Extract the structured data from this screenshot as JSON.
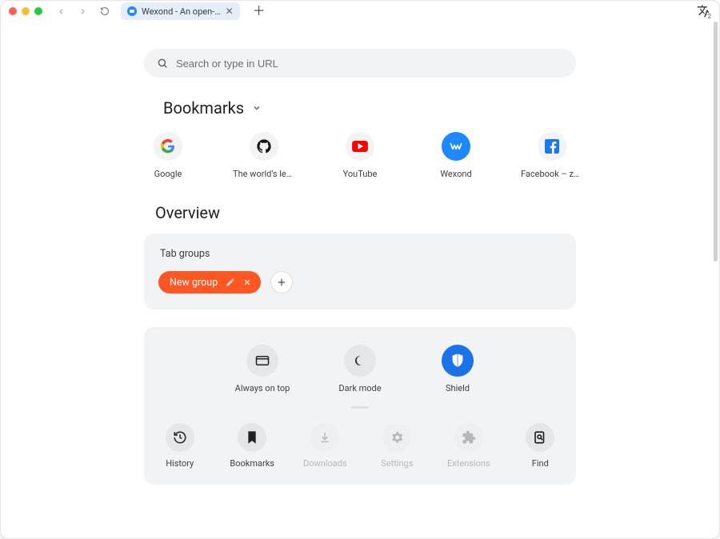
{
  "titlebar": {
    "tab_title": "Wexond - An open-…",
    "translate_badge": "2"
  },
  "search": {
    "placeholder": "Search or type in URL"
  },
  "sections": {
    "bookmarks_title": "Bookmarks",
    "overview_title": "Overview",
    "tab_groups_title": "Tab groups"
  },
  "bookmarks": [
    {
      "label": "Google"
    },
    {
      "label": "The world's lead…"
    },
    {
      "label": "YouTube"
    },
    {
      "label": "Wexond"
    },
    {
      "label": "Facebook – zal…"
    }
  ],
  "tab_groups": {
    "new_group_label": "New group"
  },
  "quick": [
    {
      "label": "Always on top",
      "on": false
    },
    {
      "label": "Dark mode",
      "on": false
    },
    {
      "label": "Shield",
      "on": true
    }
  ],
  "tools": [
    {
      "label": "History",
      "dim": false
    },
    {
      "label": "Bookmarks",
      "dim": false
    },
    {
      "label": "Downloads",
      "dim": true
    },
    {
      "label": "Settings",
      "dim": true
    },
    {
      "label": "Extensions",
      "dim": true
    },
    {
      "label": "Find",
      "dim": false
    }
  ],
  "colors": {
    "accent": "#1a73e8",
    "group": "#ff5722"
  }
}
